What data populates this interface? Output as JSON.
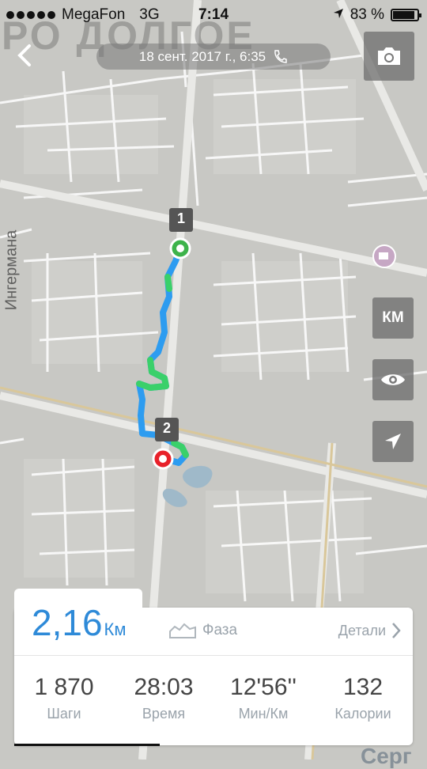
{
  "status_bar": {
    "carrier": "MegaFon",
    "network": "3G",
    "time": "7:14",
    "battery": "83 %",
    "battery_level": 0.83
  },
  "map": {
    "district_label": "РО ДОЛГОЕ",
    "side_street_label": "Ингермана",
    "bottom_label": "Серг",
    "markers": [
      {
        "label": "1",
        "kind": "start",
        "color": "#3db34a"
      },
      {
        "label": "2",
        "kind": "finish",
        "color": "#e8212a"
      }
    ],
    "route_colors": [
      "#2d9cf0",
      "#3ad06a"
    ]
  },
  "header": {
    "date_time": "18 сент. 2017 г., 6:35",
    "back_icon": "chevron-left-icon",
    "phone_icon": "phone-icon",
    "camera_icon": "camera-icon"
  },
  "controls": {
    "unit_button": "КМ",
    "eye_icon": "eye-icon",
    "locate_icon": "navigation-arrow-icon"
  },
  "summary": {
    "distance_value": "2,16",
    "distance_unit": "Км",
    "phase_label": "Фаза",
    "details_label": "Детали",
    "accent_color": "#2e8ad8",
    "stats": [
      {
        "value": "1 870",
        "label": "Шаги"
      },
      {
        "value": "28:03",
        "label": "Время"
      },
      {
        "value": "12'56''",
        "label": "Мин/Км"
      },
      {
        "value": "132",
        "label": "Калории"
      }
    ]
  }
}
